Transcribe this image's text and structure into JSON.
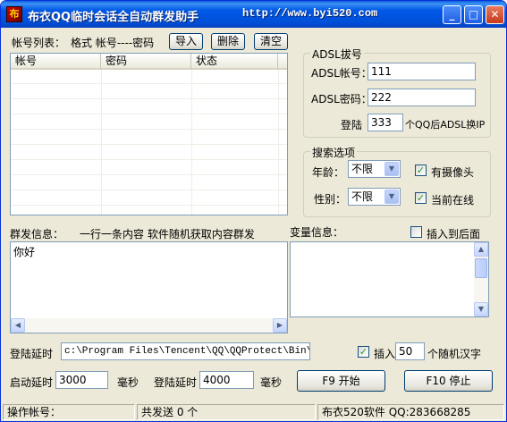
{
  "window": {
    "title": "布衣QQ临时会话全自动群发助手",
    "url": "http://www.byi520.com",
    "icon_text": "布"
  },
  "toolbar": {
    "account_list_label": "帐号列表：",
    "format_label": "格式 帐号----密码",
    "import_label": "导入",
    "delete_label": "删除",
    "clear_label": "清空"
  },
  "account_table": {
    "columns": [
      "帐号",
      "密码",
      "状态"
    ],
    "rows": []
  },
  "adsl": {
    "group_title": "ADSL拔号",
    "account_label": "ADSL帐号：",
    "account_value": "111",
    "password_label": "ADSL密码：",
    "password_value": "222",
    "login_label": "登陆",
    "login_count": "333",
    "login_suffix": "个QQ后ADSL换IP"
  },
  "search": {
    "group_title": "搜索选项",
    "age_label": "年龄：",
    "age_value": "不限",
    "camera_label": "有摄像头",
    "camera_checked": true,
    "gender_label": "性别：",
    "gender_value": "不限",
    "online_label": "当前在线",
    "online_checked": true
  },
  "message": {
    "label": "群发信息：",
    "hint": "一行一条内容  软件随机获取内容群发",
    "content": "你好",
    "variable_label": "变量信息：",
    "insert_end_label": "插入到后面",
    "insert_end_checked": false
  },
  "settings": {
    "login_delay_label": "登陆延时",
    "path_value": "c:\\Program Files\\Tencent\\QQ\\QQProtect\\Bin\\QQPr",
    "insert_label": "插入",
    "insert_checked": true,
    "insert_count": "50",
    "random_chars_label": "个随机汉字",
    "start_delay_label": "启动延时",
    "start_delay_value": "3000",
    "ms_label_1": "毫秒",
    "login_delay_label_2": "登陆延时",
    "login_delay_value": "4000",
    "ms_label_2": "毫秒",
    "start_button": "F9 开始",
    "stop_button": "F10 停止"
  },
  "status": {
    "operating_account": "操作帐号：",
    "sent_total": "共发送 0 个",
    "credit": "布衣520软件 QQ:283668285"
  }
}
